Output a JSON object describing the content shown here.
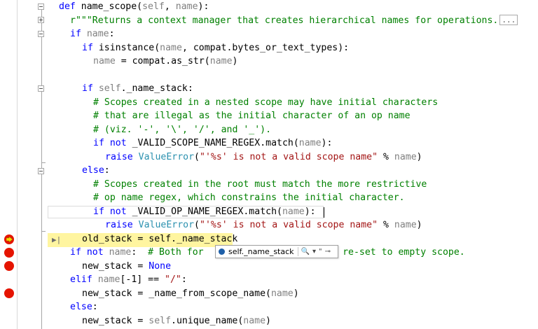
{
  "editor": {
    "lines": [
      [
        {
          "t": "def ",
          "c": "kw"
        },
        {
          "t": "name_scope(",
          "c": "op"
        },
        {
          "t": "self",
          "c": "gr"
        },
        {
          "t": ", ",
          "c": "op"
        },
        {
          "t": "name",
          "c": "gr"
        },
        {
          "t": "):",
          "c": "op"
        }
      ],
      [
        {
          "t": "r\"\"\"Returns a context manager that creates hierarchical names for operations.",
          "c": "cm"
        }
      ],
      [
        {
          "t": "if ",
          "c": "kw"
        },
        {
          "t": "name",
          "c": "gr"
        },
        {
          "t": ":",
          "c": "op"
        }
      ],
      [
        {
          "t": "if ",
          "c": "kw"
        },
        {
          "t": "isinstance(",
          "c": "op"
        },
        {
          "t": "name",
          "c": "gr"
        },
        {
          "t": ", compat.bytes_or_text_types):",
          "c": "op"
        }
      ],
      [
        {
          "t": "name",
          "c": "gr"
        },
        {
          "t": " = compat.as_str(",
          "c": "op"
        },
        {
          "t": "name",
          "c": "gr"
        },
        {
          "t": ")",
          "c": "op"
        }
      ],
      [],
      [
        {
          "t": "if ",
          "c": "kw"
        },
        {
          "t": "self",
          "c": "gr"
        },
        {
          "t": "._name_stack:",
          "c": "op"
        }
      ],
      [
        {
          "t": "# Scopes created in a nested scope may have initial characters",
          "c": "cm"
        }
      ],
      [
        {
          "t": "# that are illegal as the initial character of an op name",
          "c": "cm"
        }
      ],
      [
        {
          "t": "# (viz. '-', '\\', '/', and '_').",
          "c": "cm"
        }
      ],
      [
        {
          "t": "if not ",
          "c": "kw"
        },
        {
          "t": "_VALID_SCOPE_NAME_REGEX.match(",
          "c": "op"
        },
        {
          "t": "name",
          "c": "gr"
        },
        {
          "t": "):",
          "c": "op"
        }
      ],
      [
        {
          "t": "raise ",
          "c": "kw"
        },
        {
          "t": "ValueError",
          "c": "bi"
        },
        {
          "t": "(",
          "c": "op"
        },
        {
          "t": "\"'%s' is not a valid scope name\"",
          "c": "st"
        },
        {
          "t": " % ",
          "c": "op"
        },
        {
          "t": "name",
          "c": "gr"
        },
        {
          "t": ")",
          "c": "op"
        }
      ],
      [
        {
          "t": "else",
          "c": "kw"
        },
        {
          "t": ":",
          "c": "op"
        }
      ],
      [
        {
          "t": "# Scopes created in the root must match the more restrictive",
          "c": "cm"
        }
      ],
      [
        {
          "t": "# op name regex, which constrains the initial character.",
          "c": "cm"
        }
      ],
      [
        {
          "t": "if not ",
          "c": "kw"
        },
        {
          "t": "_VALID_OP_NAME_REGEX.match(",
          "c": "op"
        },
        {
          "t": "name",
          "c": "gr"
        },
        {
          "t": "):",
          "c": "op"
        }
      ],
      [
        {
          "t": "raise ",
          "c": "kw"
        },
        {
          "t": "ValueError",
          "c": "bi"
        },
        {
          "t": "(",
          "c": "op"
        },
        {
          "t": "\"'%s' is not a valid scope name\"",
          "c": "st"
        },
        {
          "t": " % ",
          "c": "op"
        },
        {
          "t": "name",
          "c": "gr"
        },
        {
          "t": ")",
          "c": "op"
        }
      ],
      [
        {
          "t": "old_stack = self._name_stack",
          "c": "op"
        }
      ],
      [
        {
          "t": "if not ",
          "c": "kw"
        },
        {
          "t": "name",
          "c": "gr"
        },
        {
          "t": ":  ",
          "c": "op"
        },
        {
          "t": "# Both for ",
          "c": "cm"
        },
        {
          "t": "                     ",
          "c": "op"
        },
        {
          "t": "we re-set to empty scope.",
          "c": "cm"
        }
      ],
      [
        {
          "t": "new_stack = ",
          "c": "op"
        },
        {
          "t": "None",
          "c": "kw"
        }
      ],
      [
        {
          "t": "elif ",
          "c": "kw"
        },
        {
          "t": "name",
          "c": "gr"
        },
        {
          "t": "[-1] == ",
          "c": "op"
        },
        {
          "t": "\"/\"",
          "c": "st"
        },
        {
          "t": ":",
          "c": "op"
        }
      ],
      [
        {
          "t": "new_stack = _name_from_scope_name(",
          "c": "op"
        },
        {
          "t": "name",
          "c": "gr"
        },
        {
          "t": ")",
          "c": "op"
        }
      ],
      [
        {
          "t": "else",
          "c": "kw"
        },
        {
          "t": ":",
          "c": "op"
        }
      ],
      [
        {
          "t": "new_stack = ",
          "c": "op"
        },
        {
          "t": "self",
          "c": "gr"
        },
        {
          "t": ".unique_name(",
          "c": "op"
        },
        {
          "t": "name",
          "c": "gr"
        },
        {
          "t": ")",
          "c": "op"
        }
      ]
    ],
    "docstring_ellipsis": "...",
    "current_line_index": 17,
    "breakpoint_line_indices": [
      19,
      21
    ]
  },
  "datatip": {
    "expression": "self._name_stack",
    "search_glyph": "🔍",
    "dropdown_glyph": "▾",
    "quote_glyph": "\"",
    "pin_glyph": "⊸",
    "icon": "field-icon"
  },
  "colors": {
    "keyword": "#0000ff",
    "comment": "#008000",
    "string": "#a31515",
    "builtin": "#2b91af",
    "param": "#808080",
    "breakpoint": "#e51400",
    "current_statement": "#fff5a0"
  }
}
